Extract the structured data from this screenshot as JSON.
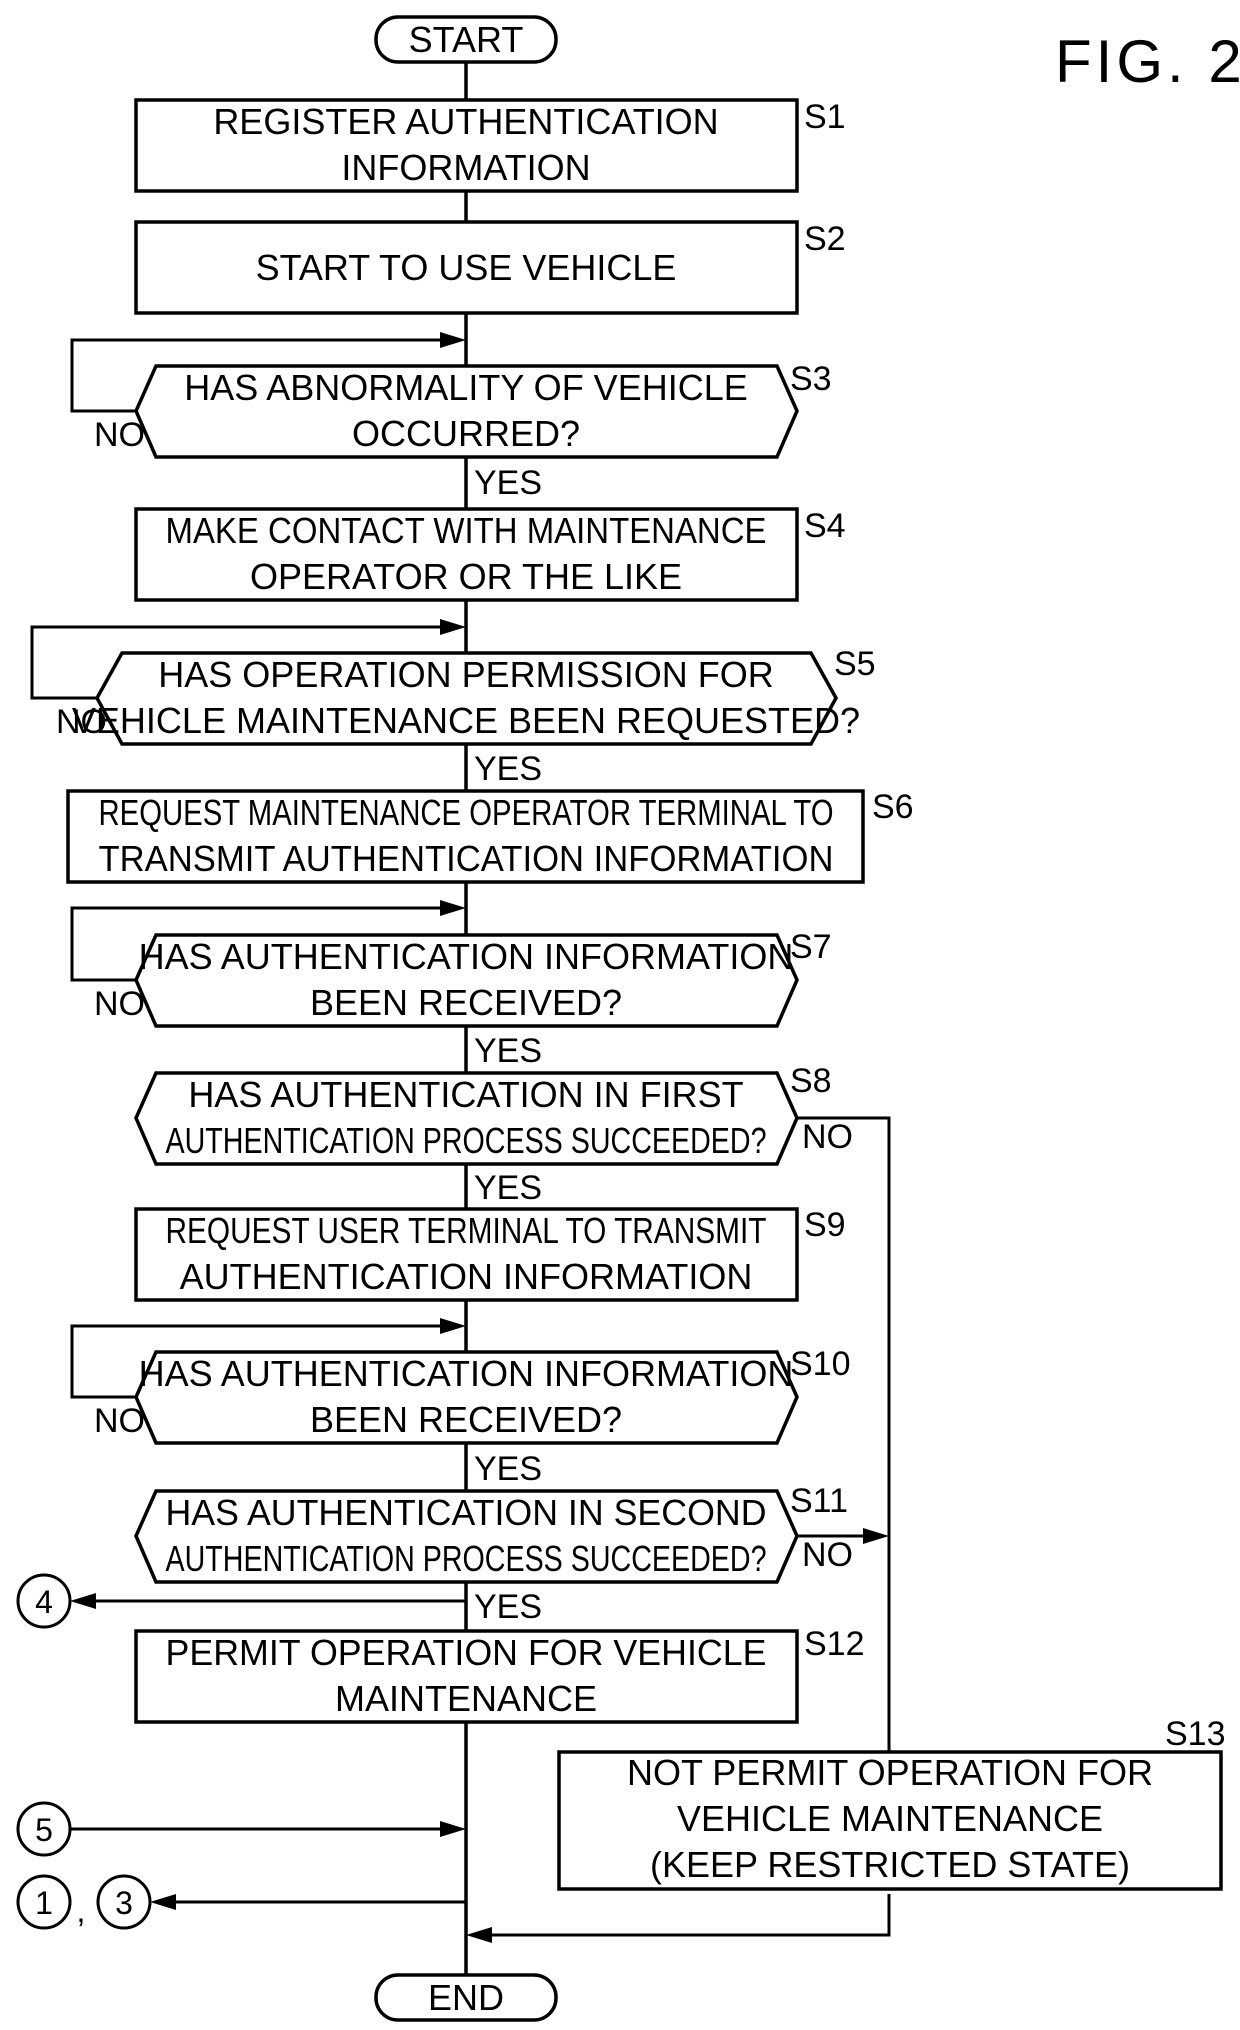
{
  "figure_label": "FIG. 2",
  "terminals": {
    "start": "START",
    "end": "END"
  },
  "steps": {
    "S1": {
      "id": "S1",
      "lines": [
        "REGISTER AUTHENTICATION",
        "INFORMATION"
      ]
    },
    "S2": {
      "id": "S2",
      "lines": [
        "START TO USE VEHICLE"
      ]
    },
    "S3": {
      "id": "S3",
      "lines": [
        "HAS ABNORMALITY OF VEHICLE",
        "OCCURRED?"
      ]
    },
    "S4": {
      "id": "S4",
      "lines": [
        "MAKE CONTACT WITH MAINTENANCE",
        "OPERATOR OR THE LIKE"
      ]
    },
    "S5": {
      "id": "S5",
      "lines": [
        "HAS OPERATION PERMISSION FOR",
        "VEHICLE MAINTENANCE BEEN REQUESTED?"
      ]
    },
    "S6": {
      "id": "S6",
      "lines": [
        "REQUEST MAINTENANCE OPERATOR TERMINAL TO",
        "TRANSMIT AUTHENTICATION INFORMATION"
      ]
    },
    "S7": {
      "id": "S7",
      "lines": [
        "HAS AUTHENTICATION INFORMATION",
        "BEEN RECEIVED?"
      ]
    },
    "S8": {
      "id": "S8",
      "lines": [
        "HAS AUTHENTICATION IN FIRST",
        "AUTHENTICATION PROCESS SUCCEEDED?"
      ]
    },
    "S9": {
      "id": "S9",
      "lines": [
        "REQUEST USER TERMINAL TO TRANSMIT",
        "AUTHENTICATION INFORMATION"
      ]
    },
    "S10": {
      "id": "S10",
      "lines": [
        "HAS AUTHENTICATION INFORMATION",
        "BEEN RECEIVED?"
      ]
    },
    "S11": {
      "id": "S11",
      "lines": [
        "HAS AUTHENTICATION IN SECOND",
        "AUTHENTICATION PROCESS SUCCEEDED?"
      ]
    },
    "S12": {
      "id": "S12",
      "lines": [
        "PERMIT OPERATION FOR VEHICLE",
        "MAINTENANCE"
      ]
    },
    "S13": {
      "id": "S13",
      "lines": [
        "NOT PERMIT OPERATION FOR",
        "VEHICLE MAINTENANCE",
        "(KEEP RESTRICTED STATE)"
      ]
    }
  },
  "branch_labels": {
    "yes": "YES",
    "no": "NO"
  },
  "connectors": {
    "c4": "4",
    "c5": "5",
    "c1": "1",
    "c3": "3",
    "separator": ","
  }
}
